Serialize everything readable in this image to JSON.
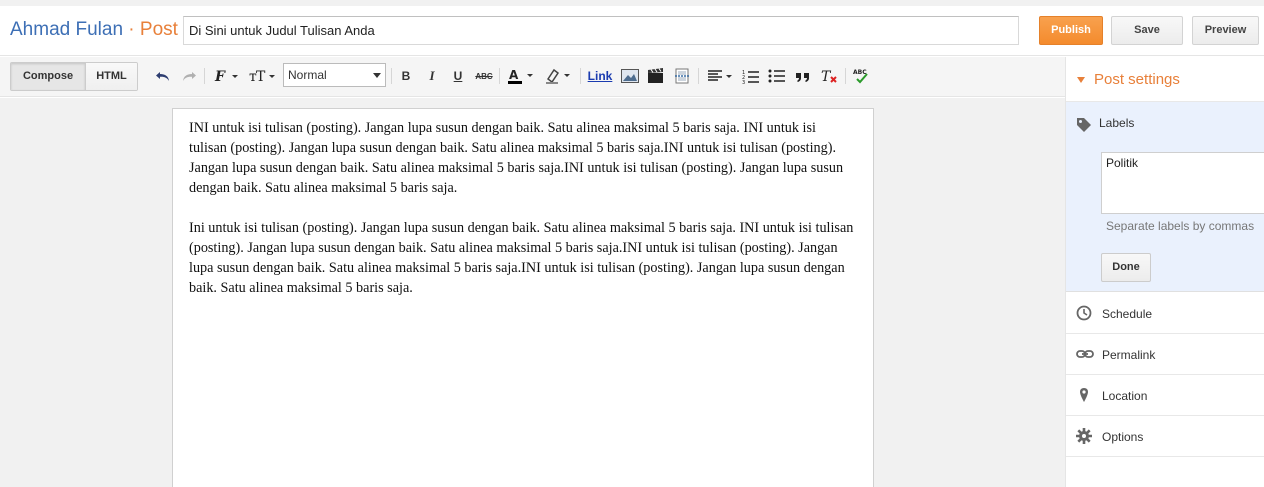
{
  "header": {
    "blog_name": "Ahmad Fulan",
    "separator": " · ",
    "section": "Post",
    "title_value": "Di Sini untuk Judul Tulisan Anda",
    "publish_label": "Publish",
    "save_label": "Save",
    "preview_label": "Preview",
    "accent_color": "#f48b2d",
    "blog_name_color": "#3d6fb5"
  },
  "toolbar": {
    "compose_label": "Compose",
    "html_label": "HTML",
    "font_size_select": "Normal",
    "link_label": "Link",
    "icons": [
      "undo-icon",
      "redo-icon",
      "font-family-icon",
      "font-size-icon",
      "bold-icon",
      "italic-icon",
      "underline-icon",
      "strikethrough-icon",
      "text-color-icon",
      "highlight-icon",
      "link",
      "image-icon",
      "video-icon",
      "jump-break-icon",
      "align-icon",
      "numbered-list-icon",
      "bullet-list-icon",
      "quote-icon",
      "remove-formatting-icon",
      "spellcheck-icon"
    ]
  },
  "editor": {
    "paragraphs": [
      "INI untuk isi tulisan (posting). Jangan lupa susun dengan baik. Satu alinea maksimal 5 baris saja. INI untuk isi tulisan (posting). Jangan lupa susun dengan baik. Satu alinea maksimal 5 baris saja.INI untuk isi tulisan (posting). Jangan lupa susun dengan baik. Satu alinea maksimal 5 baris saja.INI untuk isi tulisan (posting). Jangan lupa susun dengan baik. Satu alinea maksimal 5 baris saja.",
      "Ini untuk isi tulisan (posting). Jangan lupa susun dengan baik. Satu alinea maksimal 5 baris saja. INI untuk isi tulisan (posting). Jangan lupa susun dengan baik. Satu alinea maksimal 5 baris saja.INI untuk isi tulisan (posting). Jangan lupa susun dengan baik. Satu alinea maksimal 5 baris saja.INI untuk isi tulisan (posting). Jangan lupa susun dengan baik. Satu alinea maksimal 5 baris saja."
    ]
  },
  "sidebar": {
    "title": "Post settings",
    "labels": {
      "title": "Labels",
      "value": "Politik",
      "hint": "Separate labels by commas",
      "done_label": "Done"
    },
    "items": [
      {
        "label": "Schedule",
        "icon": "clock-icon"
      },
      {
        "label": "Permalink",
        "icon": "link-icon"
      },
      {
        "label": "Location",
        "icon": "pin-icon"
      },
      {
        "label": "Options",
        "icon": "gear-icon"
      }
    ]
  }
}
